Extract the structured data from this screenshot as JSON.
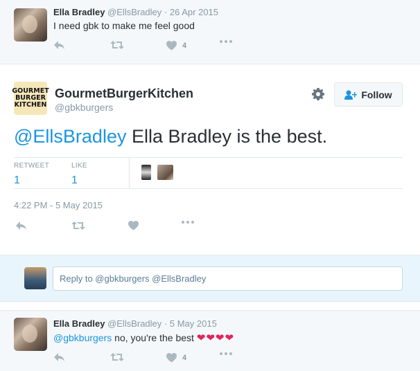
{
  "top_tweet": {
    "name": "Ella Bradley",
    "handle": "@EllsBradley",
    "separator": "·",
    "date": "26 Apr 2015",
    "text": "I need gbk to make me feel good",
    "like_count": "4"
  },
  "main_tweet": {
    "logo_lines": [
      "GOURMET",
      "BURGER",
      "KITCHEN"
    ],
    "name": "GourmetBurgerKitchen",
    "handle": "@gbkburgers",
    "follow_label": "Follow",
    "mention": "@EllsBradley",
    "text": " Ella Bradley is the best.",
    "retweet_label": "RETWEET",
    "retweet_count": "1",
    "like_label": "LIKE",
    "like_count": "1",
    "timestamp": "4:22 PM - 5 May 2015"
  },
  "reply_box": {
    "placeholder": "Reply to @gbkburgers @EllsBradley"
  },
  "reply_tweet": {
    "name": "Ella Bradley",
    "handle": "@EllsBradley",
    "separator": "·",
    "date": "5 May 2015",
    "mention": "@gbkburgers",
    "text": " no, you're the best ",
    "hearts": "❤❤❤❤",
    "like_count": "4"
  },
  "colors": {
    "link": "#1b95e0",
    "muted": "#8899a6",
    "icon": "#aab8c2",
    "heart": "#e0245e",
    "reply_bg": "#e8f5fd"
  },
  "icons": [
    "reply-icon",
    "retweet-icon",
    "heart-icon",
    "more-icon",
    "gear-icon",
    "follow-user-icon"
  ]
}
